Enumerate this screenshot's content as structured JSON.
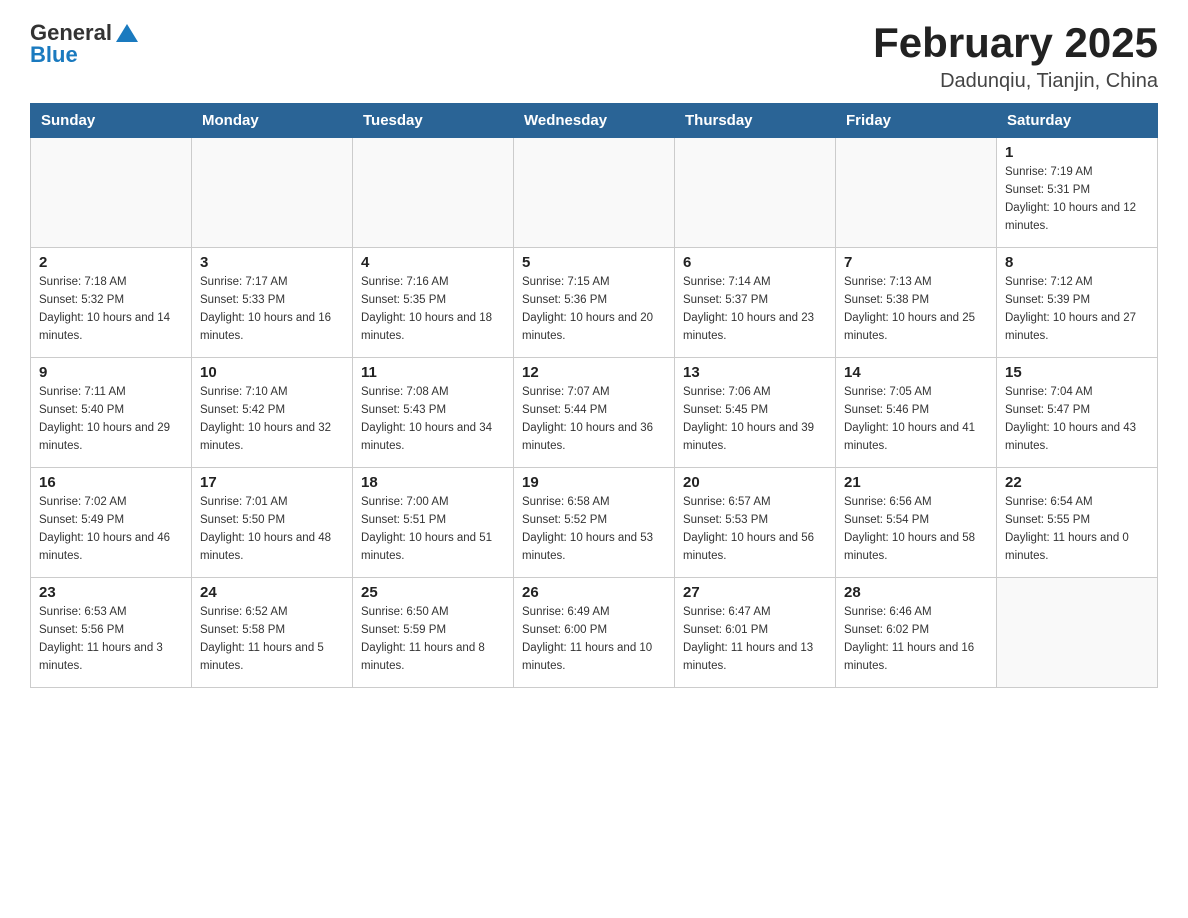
{
  "header": {
    "logo_general": "General",
    "logo_blue": "Blue",
    "title": "February 2025",
    "subtitle": "Dadunqiu, Tianjin, China"
  },
  "days_of_week": [
    "Sunday",
    "Monday",
    "Tuesday",
    "Wednesday",
    "Thursday",
    "Friday",
    "Saturday"
  ],
  "weeks": [
    [
      {
        "day": "",
        "sunrise": "",
        "sunset": "",
        "daylight": ""
      },
      {
        "day": "",
        "sunrise": "",
        "sunset": "",
        "daylight": ""
      },
      {
        "day": "",
        "sunrise": "",
        "sunset": "",
        "daylight": ""
      },
      {
        "day": "",
        "sunrise": "",
        "sunset": "",
        "daylight": ""
      },
      {
        "day": "",
        "sunrise": "",
        "sunset": "",
        "daylight": ""
      },
      {
        "day": "",
        "sunrise": "",
        "sunset": "",
        "daylight": ""
      },
      {
        "day": "1",
        "sunrise": "Sunrise: 7:19 AM",
        "sunset": "Sunset: 5:31 PM",
        "daylight": "Daylight: 10 hours and 12 minutes."
      }
    ],
    [
      {
        "day": "2",
        "sunrise": "Sunrise: 7:18 AM",
        "sunset": "Sunset: 5:32 PM",
        "daylight": "Daylight: 10 hours and 14 minutes."
      },
      {
        "day": "3",
        "sunrise": "Sunrise: 7:17 AM",
        "sunset": "Sunset: 5:33 PM",
        "daylight": "Daylight: 10 hours and 16 minutes."
      },
      {
        "day": "4",
        "sunrise": "Sunrise: 7:16 AM",
        "sunset": "Sunset: 5:35 PM",
        "daylight": "Daylight: 10 hours and 18 minutes."
      },
      {
        "day": "5",
        "sunrise": "Sunrise: 7:15 AM",
        "sunset": "Sunset: 5:36 PM",
        "daylight": "Daylight: 10 hours and 20 minutes."
      },
      {
        "day": "6",
        "sunrise": "Sunrise: 7:14 AM",
        "sunset": "Sunset: 5:37 PM",
        "daylight": "Daylight: 10 hours and 23 minutes."
      },
      {
        "day": "7",
        "sunrise": "Sunrise: 7:13 AM",
        "sunset": "Sunset: 5:38 PM",
        "daylight": "Daylight: 10 hours and 25 minutes."
      },
      {
        "day": "8",
        "sunrise": "Sunrise: 7:12 AM",
        "sunset": "Sunset: 5:39 PM",
        "daylight": "Daylight: 10 hours and 27 minutes."
      }
    ],
    [
      {
        "day": "9",
        "sunrise": "Sunrise: 7:11 AM",
        "sunset": "Sunset: 5:40 PM",
        "daylight": "Daylight: 10 hours and 29 minutes."
      },
      {
        "day": "10",
        "sunrise": "Sunrise: 7:10 AM",
        "sunset": "Sunset: 5:42 PM",
        "daylight": "Daylight: 10 hours and 32 minutes."
      },
      {
        "day": "11",
        "sunrise": "Sunrise: 7:08 AM",
        "sunset": "Sunset: 5:43 PM",
        "daylight": "Daylight: 10 hours and 34 minutes."
      },
      {
        "day": "12",
        "sunrise": "Sunrise: 7:07 AM",
        "sunset": "Sunset: 5:44 PM",
        "daylight": "Daylight: 10 hours and 36 minutes."
      },
      {
        "day": "13",
        "sunrise": "Sunrise: 7:06 AM",
        "sunset": "Sunset: 5:45 PM",
        "daylight": "Daylight: 10 hours and 39 minutes."
      },
      {
        "day": "14",
        "sunrise": "Sunrise: 7:05 AM",
        "sunset": "Sunset: 5:46 PM",
        "daylight": "Daylight: 10 hours and 41 minutes."
      },
      {
        "day": "15",
        "sunrise": "Sunrise: 7:04 AM",
        "sunset": "Sunset: 5:47 PM",
        "daylight": "Daylight: 10 hours and 43 minutes."
      }
    ],
    [
      {
        "day": "16",
        "sunrise": "Sunrise: 7:02 AM",
        "sunset": "Sunset: 5:49 PM",
        "daylight": "Daylight: 10 hours and 46 minutes."
      },
      {
        "day": "17",
        "sunrise": "Sunrise: 7:01 AM",
        "sunset": "Sunset: 5:50 PM",
        "daylight": "Daylight: 10 hours and 48 minutes."
      },
      {
        "day": "18",
        "sunrise": "Sunrise: 7:00 AM",
        "sunset": "Sunset: 5:51 PM",
        "daylight": "Daylight: 10 hours and 51 minutes."
      },
      {
        "day": "19",
        "sunrise": "Sunrise: 6:58 AM",
        "sunset": "Sunset: 5:52 PM",
        "daylight": "Daylight: 10 hours and 53 minutes."
      },
      {
        "day": "20",
        "sunrise": "Sunrise: 6:57 AM",
        "sunset": "Sunset: 5:53 PM",
        "daylight": "Daylight: 10 hours and 56 minutes."
      },
      {
        "day": "21",
        "sunrise": "Sunrise: 6:56 AM",
        "sunset": "Sunset: 5:54 PM",
        "daylight": "Daylight: 10 hours and 58 minutes."
      },
      {
        "day": "22",
        "sunrise": "Sunrise: 6:54 AM",
        "sunset": "Sunset: 5:55 PM",
        "daylight": "Daylight: 11 hours and 0 minutes."
      }
    ],
    [
      {
        "day": "23",
        "sunrise": "Sunrise: 6:53 AM",
        "sunset": "Sunset: 5:56 PM",
        "daylight": "Daylight: 11 hours and 3 minutes."
      },
      {
        "day": "24",
        "sunrise": "Sunrise: 6:52 AM",
        "sunset": "Sunset: 5:58 PM",
        "daylight": "Daylight: 11 hours and 5 minutes."
      },
      {
        "day": "25",
        "sunrise": "Sunrise: 6:50 AM",
        "sunset": "Sunset: 5:59 PM",
        "daylight": "Daylight: 11 hours and 8 minutes."
      },
      {
        "day": "26",
        "sunrise": "Sunrise: 6:49 AM",
        "sunset": "Sunset: 6:00 PM",
        "daylight": "Daylight: 11 hours and 10 minutes."
      },
      {
        "day": "27",
        "sunrise": "Sunrise: 6:47 AM",
        "sunset": "Sunset: 6:01 PM",
        "daylight": "Daylight: 11 hours and 13 minutes."
      },
      {
        "day": "28",
        "sunrise": "Sunrise: 6:46 AM",
        "sunset": "Sunset: 6:02 PM",
        "daylight": "Daylight: 11 hours and 16 minutes."
      },
      {
        "day": "",
        "sunrise": "",
        "sunset": "",
        "daylight": ""
      }
    ]
  ]
}
